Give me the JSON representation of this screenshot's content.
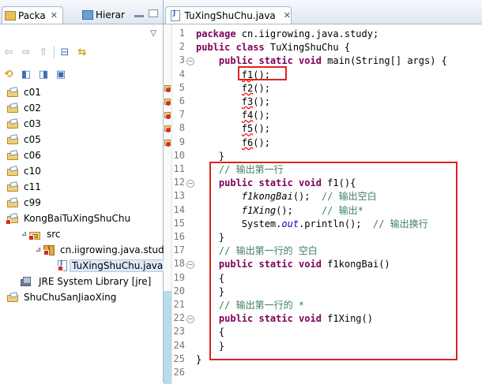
{
  "left_pane": {
    "tabs": [
      {
        "label": "Packa",
        "close": "✕"
      },
      {
        "label": "Hierar"
      }
    ],
    "view_menu": "▽",
    "tree": [
      {
        "label": "c01",
        "type": "project",
        "error": false,
        "indent": 0
      },
      {
        "label": "c02",
        "type": "project",
        "error": false,
        "indent": 0
      },
      {
        "label": "c03",
        "type": "project",
        "error": false,
        "indent": 0
      },
      {
        "label": "c05",
        "type": "project",
        "error": false,
        "indent": 0
      },
      {
        "label": "c06",
        "type": "project",
        "error": false,
        "indent": 0
      },
      {
        "label": "c10",
        "type": "project",
        "error": false,
        "indent": 0
      },
      {
        "label": "c11",
        "type": "project",
        "error": false,
        "indent": 0
      },
      {
        "label": "c99",
        "type": "project",
        "error": false,
        "indent": 0
      },
      {
        "label": "KongBaiTuXingShuChu",
        "type": "project",
        "error": true,
        "indent": 0
      },
      {
        "label": "src",
        "type": "src",
        "error": true,
        "indent": 1
      },
      {
        "label": "cn.iigrowing.java.study",
        "type": "package",
        "error": true,
        "indent": 2
      },
      {
        "label": "TuXingShuChu.java",
        "type": "java",
        "error": true,
        "indent": 3,
        "selected": true
      },
      {
        "label": "JRE System Library [jre]",
        "type": "jre",
        "error": false,
        "indent": 1
      },
      {
        "label": "ShuChuSanJiaoXing",
        "type": "project",
        "error": false,
        "indent": 0
      }
    ]
  },
  "editor": {
    "tab_label": "TuXingShuChu.java",
    "tab_close": "✕",
    "lines": [
      {
        "num": "1",
        "fold": "",
        "err": false,
        "html": "<span class='kw'>package</span> cn.iigrowing.java.study;"
      },
      {
        "num": "2",
        "fold": "",
        "err": false,
        "html": "<span class='kw'>public class</span> TuXingShuChu {"
      },
      {
        "num": "3",
        "fold": "−",
        "err": false,
        "html": "    <span class='kw'>public static void</span> main(String[] args) {"
      },
      {
        "num": "4",
        "fold": "",
        "err": false,
        "html": "        <span class='err'>f1</span>();"
      },
      {
        "num": "5",
        "fold": "",
        "err": true,
        "html": "        <span class='err'>f2</span>();"
      },
      {
        "num": "6",
        "fold": "",
        "err": true,
        "html": "        <span class='err'>f3</span>();"
      },
      {
        "num": "7",
        "fold": "",
        "err": true,
        "html": "        <span class='err'>f4</span>();"
      },
      {
        "num": "8",
        "fold": "",
        "err": true,
        "html": "        <span class='err'>f5</span>();"
      },
      {
        "num": "9",
        "fold": "",
        "err": true,
        "html": "        <span class='err'>f6</span>();"
      },
      {
        "num": "10",
        "fold": "",
        "err": false,
        "html": "    }"
      },
      {
        "num": "11",
        "fold": "",
        "err": false,
        "html": "    <span class='cm'>// 输出第一行</span>"
      },
      {
        "num": "12",
        "fold": "−",
        "err": false,
        "html": "    <span class='kw'>public static void</span> f1(){"
      },
      {
        "num": "13",
        "fold": "",
        "err": false,
        "html": "        <span class='it'>f1kongBai</span>();  <span class='cm'>// 输出空白</span>"
      },
      {
        "num": "14",
        "fold": "",
        "err": false,
        "html": "        <span class='it'>f1Xing</span>();     <span class='cm'>// 输出*</span>"
      },
      {
        "num": "15",
        "fold": "",
        "err": false,
        "html": "        System.<span class='fld'>out</span>.println();  <span class='cm'>// 输出换行</span>"
      },
      {
        "num": "16",
        "fold": "",
        "err": false,
        "html": "    }"
      },
      {
        "num": "17",
        "fold": "",
        "err": false,
        "html": "    <span class='cm'>// 输出第一行的 空白</span>"
      },
      {
        "num": "18",
        "fold": "−",
        "err": false,
        "html": "    <span class='kw'>public static void</span> f1kongBai()"
      },
      {
        "num": "19",
        "fold": "",
        "err": false,
        "html": "    {"
      },
      {
        "num": "20",
        "fold": "",
        "err": false,
        "html": "    }"
      },
      {
        "num": "21",
        "fold": "",
        "err": false,
        "html": "    <span class='cm'>// 输出第一行的 *</span>"
      },
      {
        "num": "22",
        "fold": "−",
        "err": false,
        "html": "    <span class='kw'>public static void</span> f1Xing()"
      },
      {
        "num": "23",
        "fold": "",
        "err": false,
        "html": "    {"
      },
      {
        "num": "24",
        "fold": "",
        "err": false,
        "html": "    }"
      },
      {
        "num": "25",
        "fold": "",
        "err": false,
        "html": "}"
      },
      {
        "num": "26",
        "fold": "",
        "err": false,
        "html": ""
      }
    ]
  },
  "colors": {
    "keyword": "#7f0055",
    "comment": "#3f7f5f",
    "field": "#0000c0",
    "annotation_box": "#e02222"
  }
}
